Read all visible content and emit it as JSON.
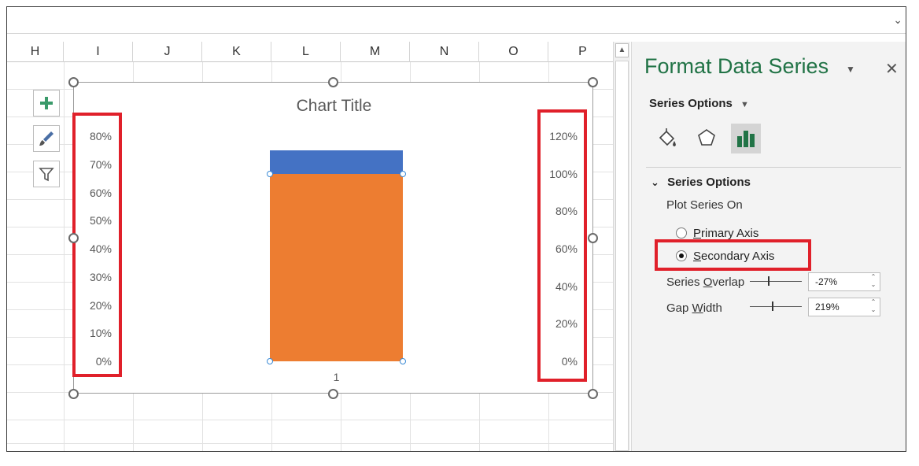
{
  "columns": [
    "H",
    "I",
    "J",
    "K",
    "L",
    "M",
    "N",
    "O",
    "P"
  ],
  "chart": {
    "title": "Chart Title",
    "primary_axis_ticks": [
      "80%",
      "70%",
      "60%",
      "50%",
      "40%",
      "30%",
      "20%",
      "10%",
      "0%"
    ],
    "secondary_axis_ticks": [
      "120%",
      "100%",
      "80%",
      "60%",
      "40%",
      "20%",
      "0%"
    ],
    "category_label": "1"
  },
  "chart_data": {
    "type": "bar",
    "title": "Chart Title",
    "categories": [
      "1"
    ],
    "primary_ylim": [
      0,
      0.8
    ],
    "secondary_ylim": [
      0,
      1.2
    ],
    "series": [
      {
        "axis": "primary",
        "color": "#4472C4",
        "values": [
          0.75
        ]
      },
      {
        "axis": "secondary",
        "color": "#ED7D31",
        "values": [
          1.0
        ]
      }
    ],
    "grid": false
  },
  "chart_buttons": [
    "plus-icon",
    "brush-icon",
    "filter-icon"
  ],
  "panel": {
    "title": "Format Data Series",
    "series_options_dropdown": "Series Options",
    "section_title": "Series Options",
    "plot_series_on": "Plot Series On",
    "primary_axis": {
      "prefix": "",
      "accel": "P",
      "rest": "rimary Axis"
    },
    "secondary_axis": {
      "prefix": "",
      "accel": "S",
      "rest": "econdary Axis"
    },
    "series_overlap": {
      "prefix": "Series ",
      "accel": "O",
      "rest": "verlap",
      "value": "-27%",
      "level": -0.27
    },
    "gap_width": {
      "prefix": "Gap ",
      "accel": "W",
      "rest": "idth",
      "value": "219%",
      "level": 2.19
    },
    "selected_axis": "secondary"
  },
  "colors": {
    "accent_green": "#217346",
    "highlight_red": "#E0202A",
    "series_blue": "#4472C4",
    "series_orange": "#ED7D31"
  }
}
